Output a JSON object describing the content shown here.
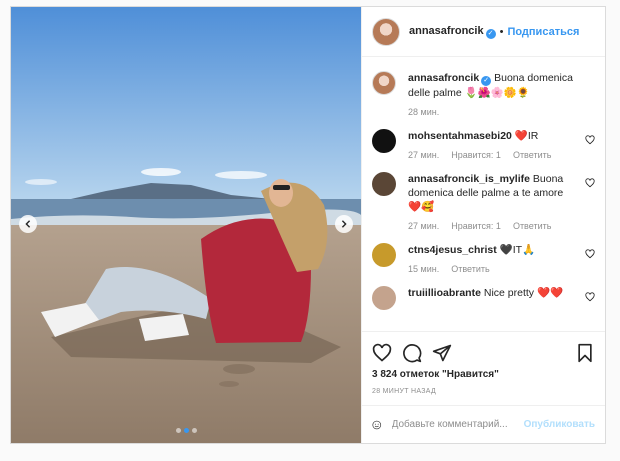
{
  "post": {
    "username": "annasafroncik",
    "separator": "•",
    "follow_label": "Подписаться",
    "verified_symbol": "✓",
    "caption": {
      "username": "annasafroncik",
      "text": " Buona domenica delle palme 🌷🌺🌸🌼🌻",
      "time": "28 мин."
    },
    "comments": [
      {
        "username": "mohsentahmasebi20",
        "text": " ❤️IR",
        "time": "27 мин.",
        "likes": "Нравится: 1",
        "reply": "Ответить",
        "avatar_color": "#111111"
      },
      {
        "username": "annasafroncik_is_mylife",
        "text": " Buona domenica delle palme a te amore ❤️🥰",
        "time": "27 мин.",
        "likes": "Нравится: 1",
        "reply": "Ответить",
        "avatar_color": "#5a4636"
      },
      {
        "username": "ctns4jesus_christ",
        "text": " 🖤IT🙏",
        "time": "15 мин.",
        "reply": "Ответить",
        "avatar_color": "#c79a2b"
      },
      {
        "username": "truiillioabrante",
        "text": " Nice pretty ❤️❤️",
        "avatar_color": "#c4a38d"
      }
    ],
    "likes_text": "3 824 отметок \"Нравится\"",
    "timestamp": "28 минут назад",
    "comment_placeholder": "Добавьте комментарий...",
    "publish_label": "Опубликовать",
    "icons": [
      "heart-icon",
      "comment-icon",
      "share-icon",
      "bookmark-icon",
      "emoji-icon",
      "chevron-left-icon",
      "chevron-right-icon",
      "verified-icon"
    ],
    "colors": {
      "accent": "#3897f0",
      "muted": "#8e8e8e",
      "like_red": "#ed4956"
    }
  }
}
